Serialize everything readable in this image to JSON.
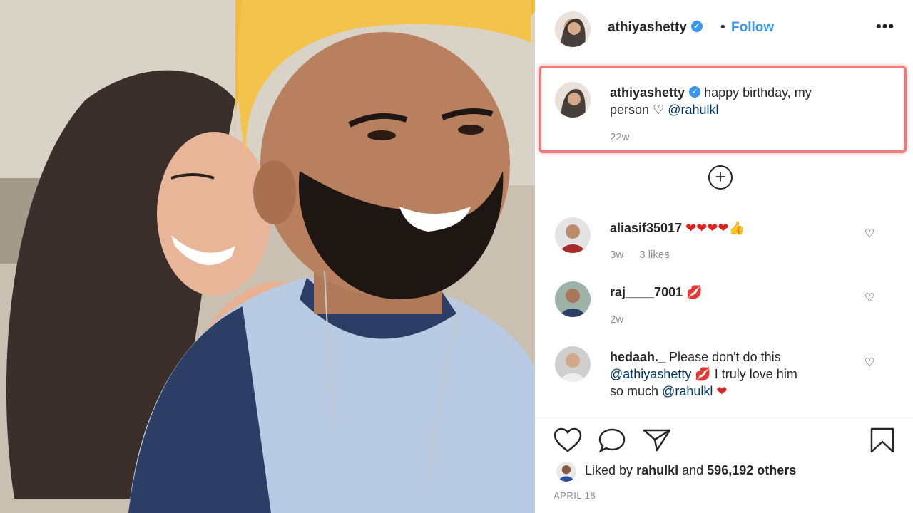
{
  "header": {
    "username": "athiyashetty",
    "separator": "•",
    "follow_label": "Follow",
    "more_label": "•••"
  },
  "caption": {
    "username": "athiyashetty",
    "text_part1": "happy birthday, my",
    "text_part2": "person",
    "heart": "♡",
    "mention": "@rahulkl",
    "time": "22w"
  },
  "load_more_label": "+",
  "comments": [
    {
      "username": "aliasif35017",
      "emoji": "❤❤❤❤👍",
      "time": "3w",
      "likes": "3 likes"
    },
    {
      "username": "raj____7001",
      "emoji": "💋",
      "time": "2w"
    },
    {
      "username": "hedaah._",
      "text1": "Please don't do this",
      "mention1": "@athiyashetty",
      "emoji1": "💋",
      "text2": "I truly love him",
      "text3": "so much",
      "mention2": "@rahulkl",
      "emoji2": "❤"
    }
  ],
  "likes": {
    "prefix": "Liked by",
    "user": "rahulkl",
    "middle": "and",
    "count": "596,192 others"
  },
  "post_date": "APRIL 18",
  "colors": {
    "accent": "#3897f0",
    "highlight": "#f07a7a",
    "text": "#262626",
    "muted": "#8e8e8e"
  }
}
